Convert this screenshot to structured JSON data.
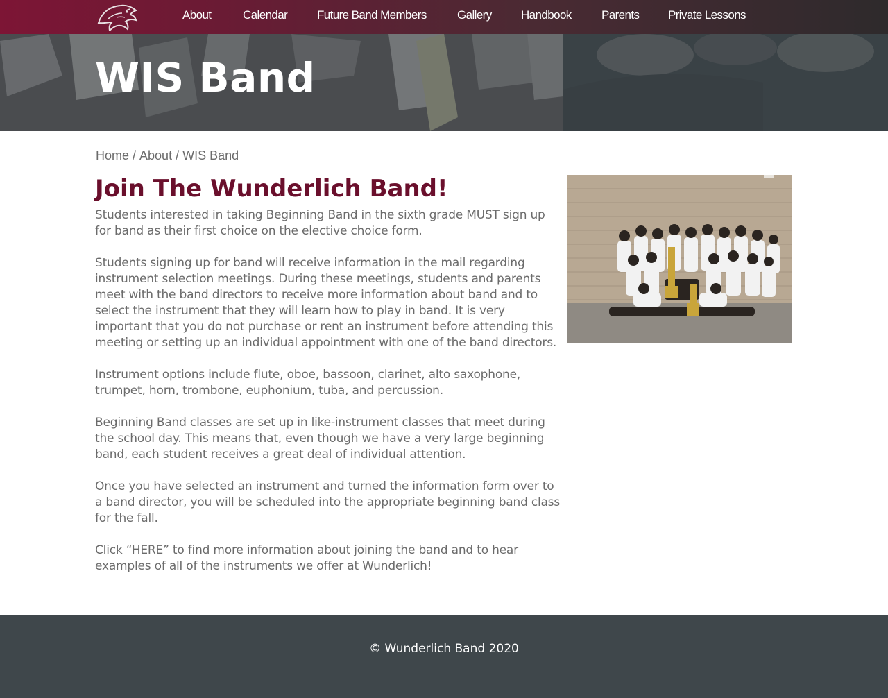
{
  "nav": {
    "items": [
      {
        "label": "About"
      },
      {
        "label": "Calendar"
      },
      {
        "label": "Future Band Members"
      },
      {
        "label": "Gallery"
      },
      {
        "label": "Handbook"
      },
      {
        "label": "Parents"
      },
      {
        "label": "Private Lessons"
      }
    ],
    "logo_icon": "panther-logo-icon"
  },
  "hero": {
    "title": "WIS Band",
    "bg_text": "WIS\nBAND"
  },
  "breadcrumb": {
    "items": [
      {
        "label": "Home"
      },
      {
        "label": "About"
      },
      {
        "label": "WIS Band"
      }
    ],
    "separator": "/"
  },
  "content": {
    "heading": "Join The Wunderlich Band!",
    "paragraphs": [
      "Students interested in taking Beginning Band in the sixth grade MUST sign up for band as their first choice on the elective choice form.",
      "Students signing up for band will receive information in the mail regarding instrument selection meetings. During these meetings, students and parents meet with the band directors to receive more information about band and to select the instrument that they will learn how to play in band. It is very important that you do not purchase or rent an instrument before attending this meeting or setting up an individual appointment with one of the band directors.",
      "Instrument options include flute, oboe, bassoon, clarinet, alto saxophone, trumpet, horn, trombone, euphonium, tuba, and percussion.",
      "Beginning Band classes are set up in like-instrument classes that meet during the school day. This means that, even though we have a very large beginning band, each student receives a great deal of individual attention.",
      "Once you have selected an instrument and turned the information form over to a band director, you will be scheduled into the appropriate beginning band class for the fall.",
      "Click “HERE” to find more information about joining the band and to hear examples of all of the instruments we offer at Wunderlich!"
    ]
  },
  "footer": {
    "copyright": "© Wunderlich Band 2020"
  },
  "colors": {
    "brand_maroon": "#6a0f2c",
    "nav_start": "#7d1535",
    "nav_end": "#2e2a2c",
    "footer_bg": "#3f474b",
    "body_text": "#6b6b6b"
  }
}
